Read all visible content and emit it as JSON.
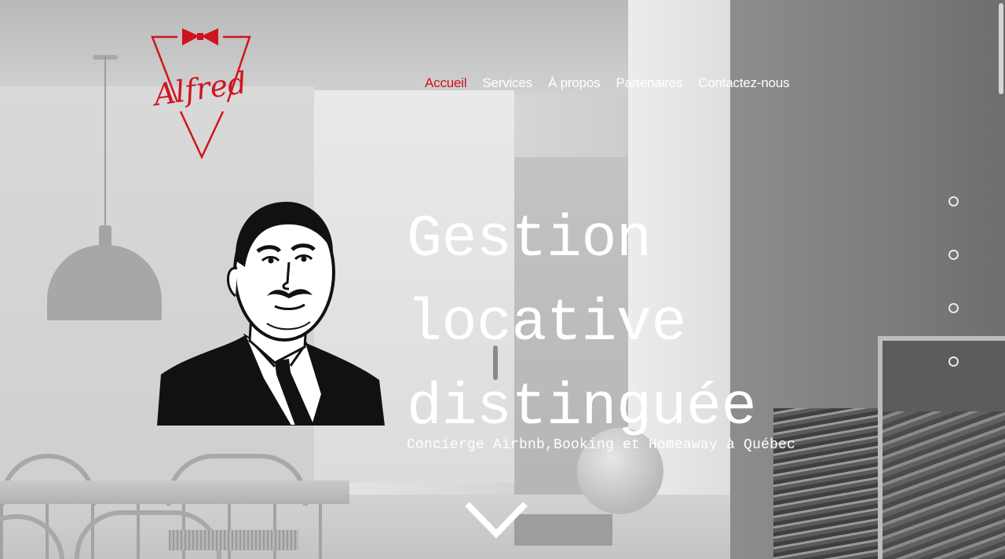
{
  "brand": {
    "name": "Alfred",
    "accent_color": "#d0141f"
  },
  "nav": {
    "items": [
      {
        "label": "Accueil",
        "active": true
      },
      {
        "label": "Services",
        "active": false
      },
      {
        "label": "À propos",
        "active": false
      },
      {
        "label": "Partenaires",
        "active": false
      },
      {
        "label": "Contactez-nous",
        "active": false
      }
    ]
  },
  "hero": {
    "title_lines": [
      "Gestion",
      "locative",
      "distinguée"
    ],
    "subtitle": "Concierge Airbnb,Booking et Homeaway à Québec",
    "illustration": "butler-portrait",
    "scroll_icon": "chevron-down-icon"
  },
  "section_dots": {
    "count": 4,
    "icon": "circle-outline-icon"
  }
}
